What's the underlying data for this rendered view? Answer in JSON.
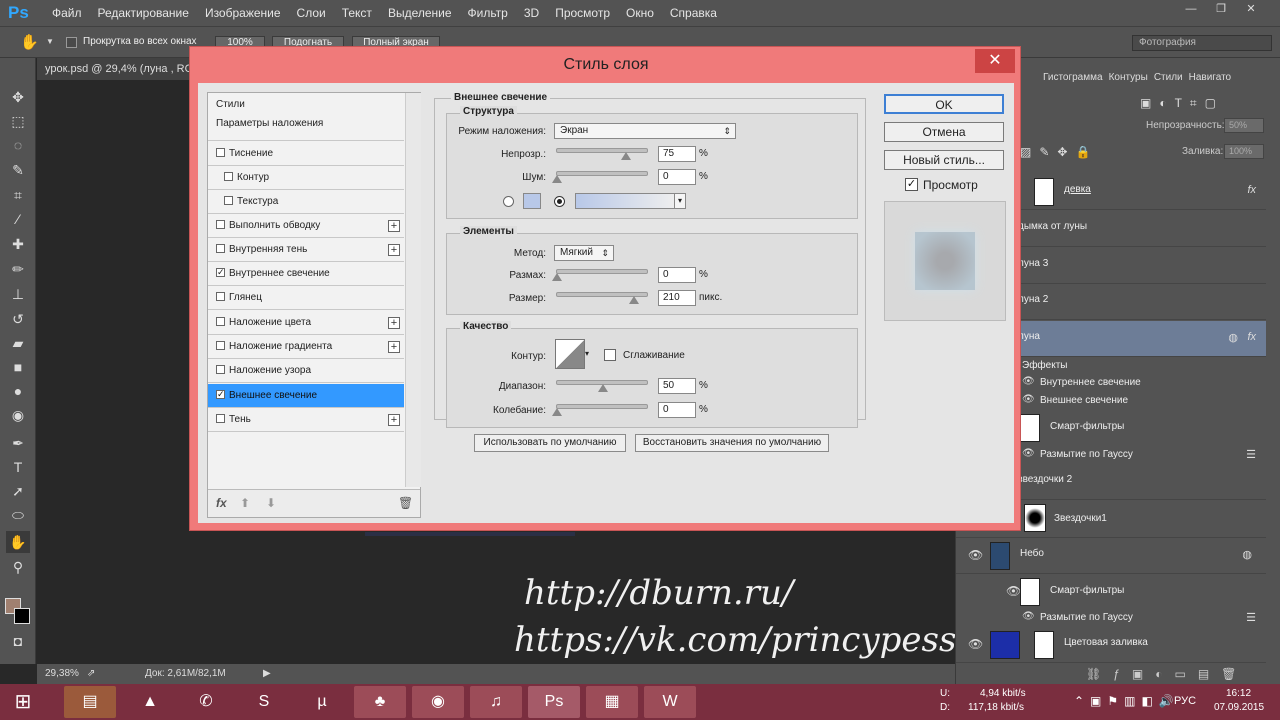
{
  "app": {
    "logo": "Ps",
    "menu": [
      "Файл",
      "Редактирование",
      "Изображение",
      "Слои",
      "Текст",
      "Выделение",
      "Фильтр",
      "3D",
      "Просмотр",
      "Окно",
      "Справка"
    ],
    "window_controls": [
      "—",
      "❐",
      "✕"
    ]
  },
  "options": {
    "scroll_all_label": "Прокрутка во всех окнах",
    "zoom_100": "100%",
    "fit": "Подогнать",
    "fullscreen": "Полный экран",
    "workspace": "Фотография"
  },
  "document": {
    "tab": "урок.psd @ 29,4% (луна , RGB",
    "zoom": "29,38%",
    "doc_info": "Док: 2,61M/82,1M"
  },
  "watermark": {
    "line1": "http://dburn.ru/",
    "line2": "https://vk.com/princypessa"
  },
  "panel": {
    "tabs": [
      "Гистограмма",
      "Контуры",
      "Стили",
      "Навигато"
    ],
    "opacity_label": "Непрозрачность:",
    "opacity_value": "50%",
    "fill_label": "Заливка:",
    "fill_value": "100%",
    "layers": {
      "devka": "девка",
      "haze": "дымка от луны",
      "luna3": "луна 3",
      "luna2": "луна 2",
      "luna": "луна",
      "effects": "Эффекты",
      "inner_glow": "Внутреннее свечение",
      "outer_glow": "Внешнее свечение",
      "smart_filters_1": "Смарт-фильтры",
      "gauss_1": "Размытие по Гауссу",
      "stars2": "звездочки 2",
      "stars1": "Звездочки1",
      "sky": "Небо",
      "smart_filters_2": "Смарт-фильтры",
      "gauss_2": "Размытие по Гауссу",
      "color_fill": "Цветовая заливка"
    }
  },
  "dialog": {
    "title": "Стиль слоя",
    "styles": {
      "styles_header": "Стили",
      "blend_options": "Параметры наложения",
      "emboss": "Тиснение",
      "contour": "Контур",
      "texture": "Текстура",
      "stroke": "Выполнить обводку",
      "inner_shadow": "Внутренняя тень",
      "inner_glow": "Внутреннее свечение",
      "satin": "Глянец",
      "color_overlay": "Наложение цвета",
      "gradient_overlay": "Наложение градиента",
      "pattern_overlay": "Наложение узора",
      "outer_glow": "Внешнее свечение",
      "drop_shadow": "Тень"
    },
    "outer_glow": {
      "section_title": "Внешнее свечение",
      "structure": {
        "title": "Структура",
        "blend_mode_label": "Режим наложения:",
        "blend_mode_value": "Экран",
        "opacity_label": "Непрозр.:",
        "opacity_value": "75",
        "opacity_level": 0.75,
        "noise_label": "Шум:",
        "noise_value": "0",
        "noise_level": 0,
        "glow_color": "#b8c8e8"
      },
      "elements": {
        "title": "Элементы",
        "technique_label": "Метод:",
        "technique_value": "Мягкий",
        "spread_label": "Размах:",
        "spread_value": "0",
        "spread_level": 0,
        "size_label": "Размер:",
        "size_value": "210",
        "size_level": 0.84,
        "size_unit": "пикс."
      },
      "quality": {
        "title": "Качество",
        "contour_label": "Контур:",
        "antialias_label": "Сглаживание",
        "range_label": "Диапазон:",
        "range_value": "50",
        "range_level": 0.5,
        "jitter_label": "Колебание:",
        "jitter_value": "0",
        "jitter_level": 0
      },
      "percent": "%",
      "make_default": "Использовать по умолчанию",
      "reset_default": "Восстановить значения по умолчанию"
    },
    "buttons": {
      "ok": "OK",
      "cancel": "Отмена",
      "new_style": "Новый стиль...",
      "preview_label": "Просмотр"
    }
  },
  "tray": {
    "upload_label": "U:",
    "download_label": "D:",
    "upload_speed": "4,94 kbit/s",
    "download_speed": "117,18 kbit/s",
    "lang": "РУС",
    "time": "16:12",
    "date": "07.09.2015"
  }
}
